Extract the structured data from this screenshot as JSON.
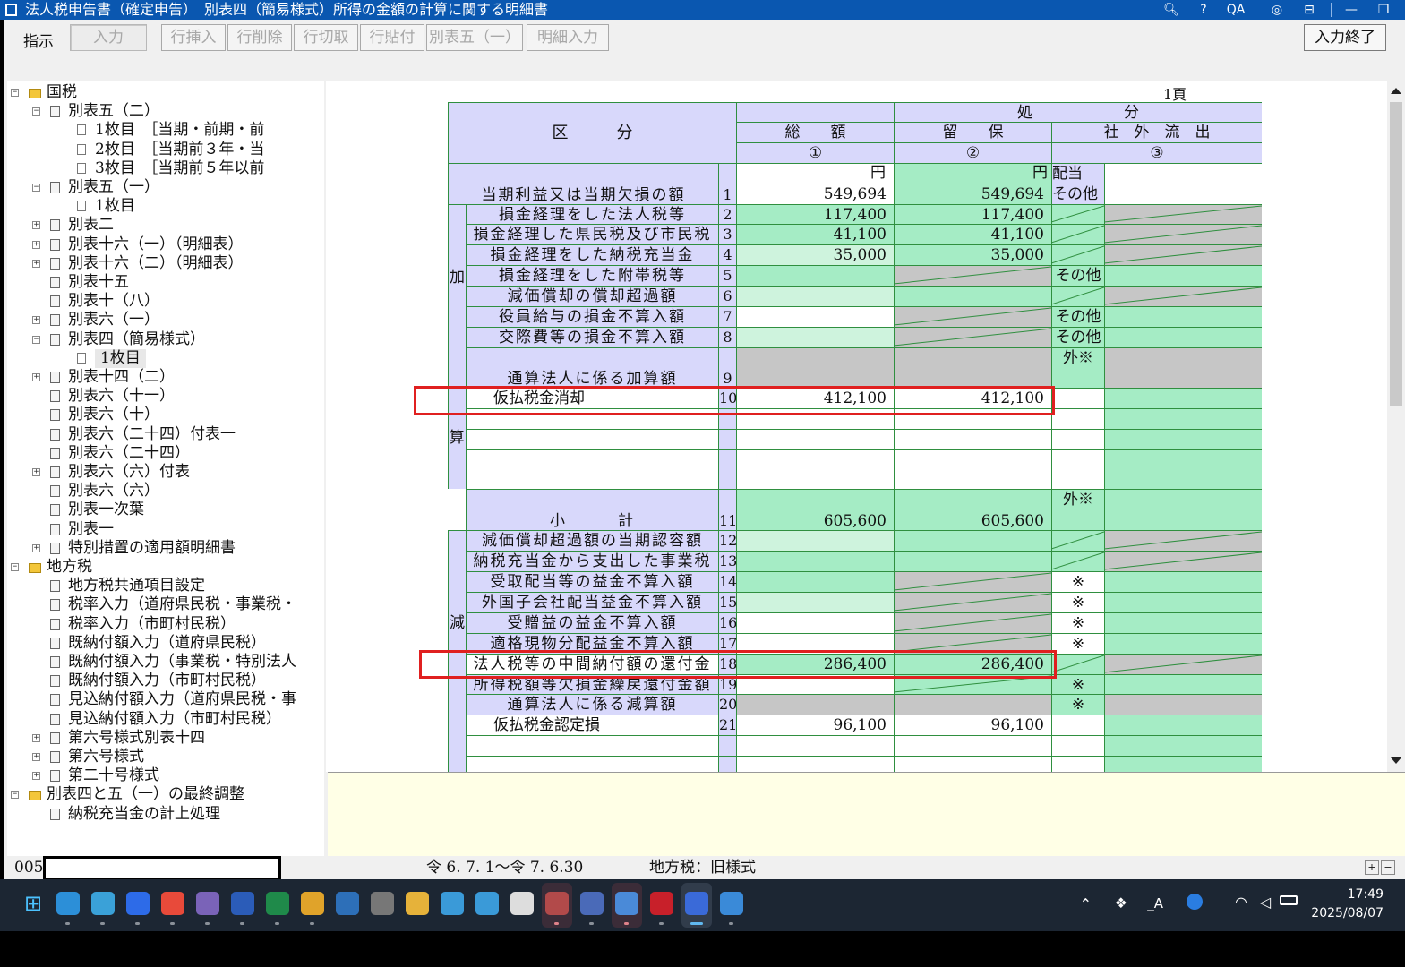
{
  "window": {
    "title": "法人税申告書（確定申告）　別表四（簡易様式）所得の金額の計算に関する明細書",
    "title_icons": [
      "zoom-icon",
      "help-icon",
      "qa-icon",
      "settings-icon",
      "layout-icon",
      "minimize-icon",
      "restore-icon"
    ]
  },
  "toolbar": {
    "label": "指示",
    "buttons": [
      "入力",
      "行挿入",
      "行削除",
      "行切取",
      "行貼付",
      "別表五（一）",
      "明細入力"
    ],
    "finish": "入力終了"
  },
  "tree": {
    "nodes": [
      {
        "label": "国税",
        "level": 0,
        "type": "folder",
        "exp": "−"
      },
      {
        "label": "別表五（二）",
        "level": 1,
        "type": "form",
        "exp": "−"
      },
      {
        "label": "1枚目　［当期・前期・前",
        "level": 2,
        "type": "page"
      },
      {
        "label": "2枚目　［当期前３年・当",
        "level": 2,
        "type": "page"
      },
      {
        "label": "3枚目　［当期前５年以前",
        "level": 2,
        "type": "page"
      },
      {
        "label": "別表五（一）",
        "level": 1,
        "type": "form",
        "exp": "−"
      },
      {
        "label": "1枚目",
        "level": 2,
        "type": "page"
      },
      {
        "label": "別表二",
        "level": 1,
        "type": "form",
        "exp": "+"
      },
      {
        "label": "別表十六（一）（明細表）",
        "level": 1,
        "type": "form",
        "exp": "+"
      },
      {
        "label": "別表十六（二）（明細表）",
        "level": 1,
        "type": "form",
        "exp": "+"
      },
      {
        "label": "別表十五",
        "level": 1,
        "type": "form"
      },
      {
        "label": "別表十（八）",
        "level": 1,
        "type": "form"
      },
      {
        "label": "別表六（一）",
        "level": 1,
        "type": "form",
        "exp": "+"
      },
      {
        "label": "別表四（簡易様式）",
        "level": 1,
        "type": "form",
        "exp": "−"
      },
      {
        "label": "1枚目",
        "level": 2,
        "type": "page",
        "selected": true
      },
      {
        "label": "別表十四（二）",
        "level": 1,
        "type": "form",
        "exp": "+"
      },
      {
        "label": "別表六（十一）",
        "level": 1,
        "type": "form"
      },
      {
        "label": "別表六（十）",
        "level": 1,
        "type": "form"
      },
      {
        "label": "別表六（二十四）付表一",
        "level": 1,
        "type": "form"
      },
      {
        "label": "別表六（二十四）",
        "level": 1,
        "type": "form"
      },
      {
        "label": "別表六（六）付表",
        "level": 1,
        "type": "form",
        "exp": "+"
      },
      {
        "label": "別表六（六）",
        "level": 1,
        "type": "form"
      },
      {
        "label": "別表一次葉",
        "level": 1,
        "type": "form"
      },
      {
        "label": "別表一",
        "level": 1,
        "type": "form"
      },
      {
        "label": "特別措置の適用額明細書",
        "level": 1,
        "type": "form",
        "exp": "+"
      },
      {
        "label": "地方税",
        "level": 0,
        "type": "folder",
        "exp": "−"
      },
      {
        "label": "地方税共通項目設定",
        "level": 1,
        "type": "form"
      },
      {
        "label": "税率入力（道府県民税・事業税・",
        "level": 1,
        "type": "form"
      },
      {
        "label": "税率入力（市町村民税）",
        "level": 1,
        "type": "form"
      },
      {
        "label": "既納付額入力（道府県民税）",
        "level": 1,
        "type": "form"
      },
      {
        "label": "既納付額入力（事業税・特別法人",
        "level": 1,
        "type": "form"
      },
      {
        "label": "既納付額入力（市町村民税）",
        "level": 1,
        "type": "form"
      },
      {
        "label": "見込納付額入力（道府県民税・事",
        "level": 1,
        "type": "form"
      },
      {
        "label": "見込納付額入力（市町村民税）",
        "level": 1,
        "type": "form"
      },
      {
        "label": "第六号様式別表十四",
        "level": 1,
        "type": "form",
        "exp": "+"
      },
      {
        "label": "第六号様式",
        "level": 1,
        "type": "form",
        "exp": "+"
      },
      {
        "label": "第二十号様式",
        "level": 1,
        "type": "form",
        "exp": "+"
      },
      {
        "label": "別表四と五（一）の最終調整",
        "level": 0,
        "type": "folder",
        "exp": "−"
      },
      {
        "label": "納税充当金の計上処理",
        "level": 1,
        "type": "form"
      }
    ]
  },
  "form": {
    "page": "1頁",
    "header": {
      "kubun": "区　　　分",
      "sogaku": "総　　額",
      "shobun": "処　　　　　　分",
      "ryuho": "留　　保",
      "shagai": "社　外　流　出",
      "c1": "①",
      "c2": "②",
      "c3": "③",
      "yen": "円"
    },
    "side": {
      "ka": "加",
      "san": "算",
      "gen": "減"
    },
    "rows": [
      {
        "no": "1",
        "label": "当期利益又は当期欠損の額",
        "total": "549,694",
        "ryuho": "549,694",
        "flow": "配当",
        "flow2": "その他"
      },
      {
        "no": "2",
        "label": "損金経理をした法人税等",
        "total": "117,400",
        "ryuho": "117,400"
      },
      {
        "no": "3",
        "label": "損金経理した県民税及び市民税",
        "total": "41,100",
        "ryuho": "41,100"
      },
      {
        "no": "4",
        "label": "損金経理をした納税充当金",
        "total": "35,000",
        "ryuho": "35,000"
      },
      {
        "no": "5",
        "label": "損金経理をした附帯税等",
        "flow": "その他"
      },
      {
        "no": "6",
        "label": "減価償却の償却超過額"
      },
      {
        "no": "7",
        "label": "役員給与の損金不算入額",
        "flow": "その他"
      },
      {
        "no": "8",
        "label": "交際費等の損金不算入額",
        "flow": "その他"
      },
      {
        "no": "9",
        "label": "通算法人に係る加算額",
        "flow": "外※"
      },
      {
        "no": "10",
        "label": "仮払税金消却",
        "total": "412,100",
        "ryuho": "412,100"
      },
      {
        "no": "11",
        "label": "小　　　計",
        "total": "605,600",
        "ryuho": "605,600",
        "flow": "外※"
      },
      {
        "no": "12",
        "label": "減価償却超過額の当期認容額"
      },
      {
        "no": "13",
        "label": "納税充当金から支出した事業税"
      },
      {
        "no": "14",
        "label": "受取配当等の益金不算入額",
        "flow": "※"
      },
      {
        "no": "15",
        "label": "外国子会社配当益金不算入額",
        "flow": "※"
      },
      {
        "no": "16",
        "label": "受贈益の益金不算入額",
        "flow": "※"
      },
      {
        "no": "17",
        "label": "適格現物分配益金不算入額",
        "flow": "※"
      },
      {
        "no": "18",
        "label": "法人税等の中間納付額の還付金",
        "total": "286,400",
        "ryuho": "286,400"
      },
      {
        "no": "19",
        "label": "所得税額等欠損金繰戻還付金額",
        "flow": "※"
      },
      {
        "no": "20",
        "label": "通算法人に係る減算額",
        "flow": "※"
      },
      {
        "no": "21",
        "label": "仮払税金認定損",
        "total": "96,100",
        "ryuho": "96,100"
      }
    ]
  },
  "status": {
    "code": "005",
    "period": "令 6. 7. 1〜令 7. 6.30",
    "local_tax": "地方税：旧様式"
  },
  "tray": {
    "time": "17:49",
    "date": "2025/08/07",
    "ime": "_A"
  },
  "taskbar": {
    "apps": [
      "start",
      "edge",
      "photos",
      "zoom",
      "app-red",
      "app-pattern",
      "word",
      "excel",
      "chrome",
      "mail",
      "pen",
      "explorer",
      "app-blue",
      "app-arrow",
      "app-doc",
      "app-red-box",
      "yayoi",
      "app-form",
      "acrobat",
      "app-note",
      "app-photo"
    ]
  }
}
